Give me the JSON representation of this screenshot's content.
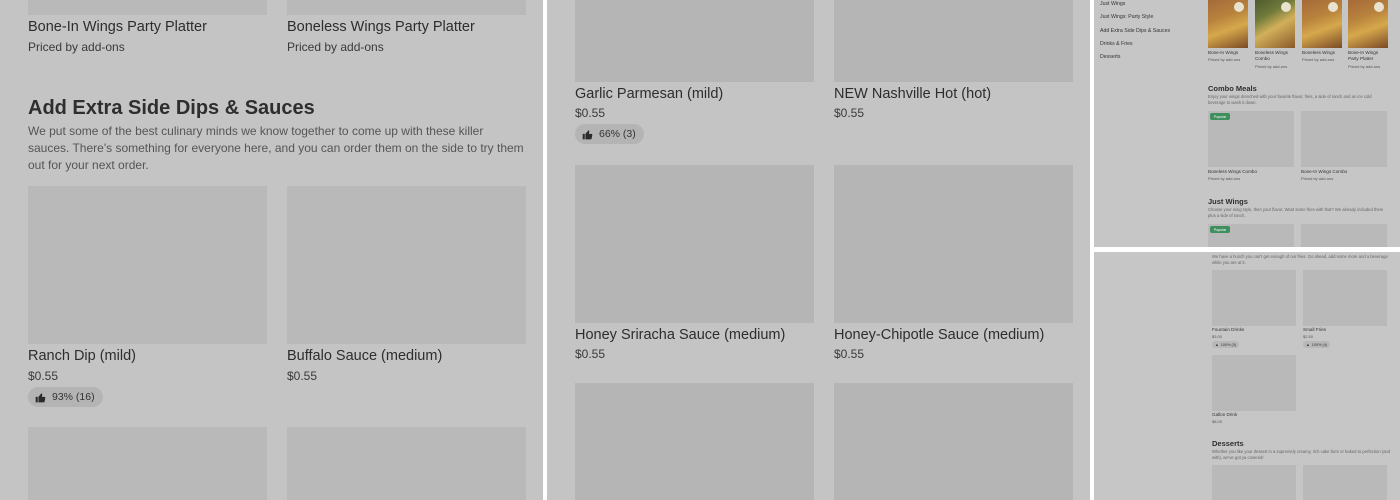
{
  "pane1": {
    "top_items": [
      {
        "name": "Bone-In Wings Party Platter",
        "price": "Priced by add-ons"
      },
      {
        "name": "Boneless Wings Party Platter",
        "price": "Priced by add-ons"
      }
    ],
    "section_title": "Add Extra Side Dips & Sauces",
    "section_desc": "We put some of the best culinary minds we know together to come up with these killer sauces. There's something for everyone here, and you can order them on the side to try them out for your next order.",
    "items": [
      {
        "name": "Ranch Dip (mild)",
        "price": "$0.55",
        "rating": "93% (16)"
      },
      {
        "name": "Buffalo Sauce (medium)",
        "price": "$0.55"
      }
    ]
  },
  "pane2": {
    "items": [
      {
        "name": "Garlic Parmesan (mild)",
        "price": "$0.55",
        "rating": "66% (3)"
      },
      {
        "name": "NEW Nashville Hot (hot)",
        "price": "$0.55"
      },
      {
        "name": "Honey Sriracha Sauce (medium)",
        "price": "$0.55"
      },
      {
        "name": "Honey-Chipotle Sauce (medium)",
        "price": "$0.55"
      }
    ]
  },
  "pane3": {
    "nav": [
      "Just Wings",
      "Just Wings: Party Style",
      "Add Extra Side Dips & Sauces",
      "Drinks & Fries",
      "Desserts"
    ],
    "wings": [
      {
        "name": "Bone-In Wings",
        "sub": "Priced by add-ons"
      },
      {
        "name": "Boneless Wings Combo",
        "sub": "Priced by add-ons"
      },
      {
        "name": "Boneless Wings",
        "sub": "Priced by add-ons"
      },
      {
        "name": "Bone-In Wings Party Platter",
        "sub": "Priced by add-ons"
      }
    ],
    "combo_title": "Combo Meals",
    "combo_desc": "Enjoy your wings drenched with your favorite flavor, fries, a side of ranch and an ice cold beverage to wash it down.",
    "popular": "Popular",
    "combo_items": [
      {
        "name": "Boneless Wings Combo",
        "sub": "Priced by add-ons"
      },
      {
        "name": "Bone-In Wings Combo",
        "sub": "Priced by add-ons"
      }
    ],
    "just_title": "Just Wings",
    "just_desc": "Choose your wing style, then your flavor. Want some fries with that? We already included them plus a side of ranch."
  },
  "pane4": {
    "top_desc": "We have a hunch you can't get enough of our fries. Go ahead, add some more and a beverage while you are at it.",
    "items": [
      {
        "name": "Fountain Drinks",
        "price": "$3.00",
        "rating": "100% (3)"
      },
      {
        "name": "Small Fries",
        "price": "$2.50",
        "rating": "100% (4)"
      },
      {
        "name": "Gallon Drink",
        "price": "$8.00"
      }
    ],
    "desserts_title": "Desserts",
    "desserts_desc": "Whether you like your dessert in a supremely creamy, rich cake form or baked to perfection (and with), we've got ya covered!"
  }
}
